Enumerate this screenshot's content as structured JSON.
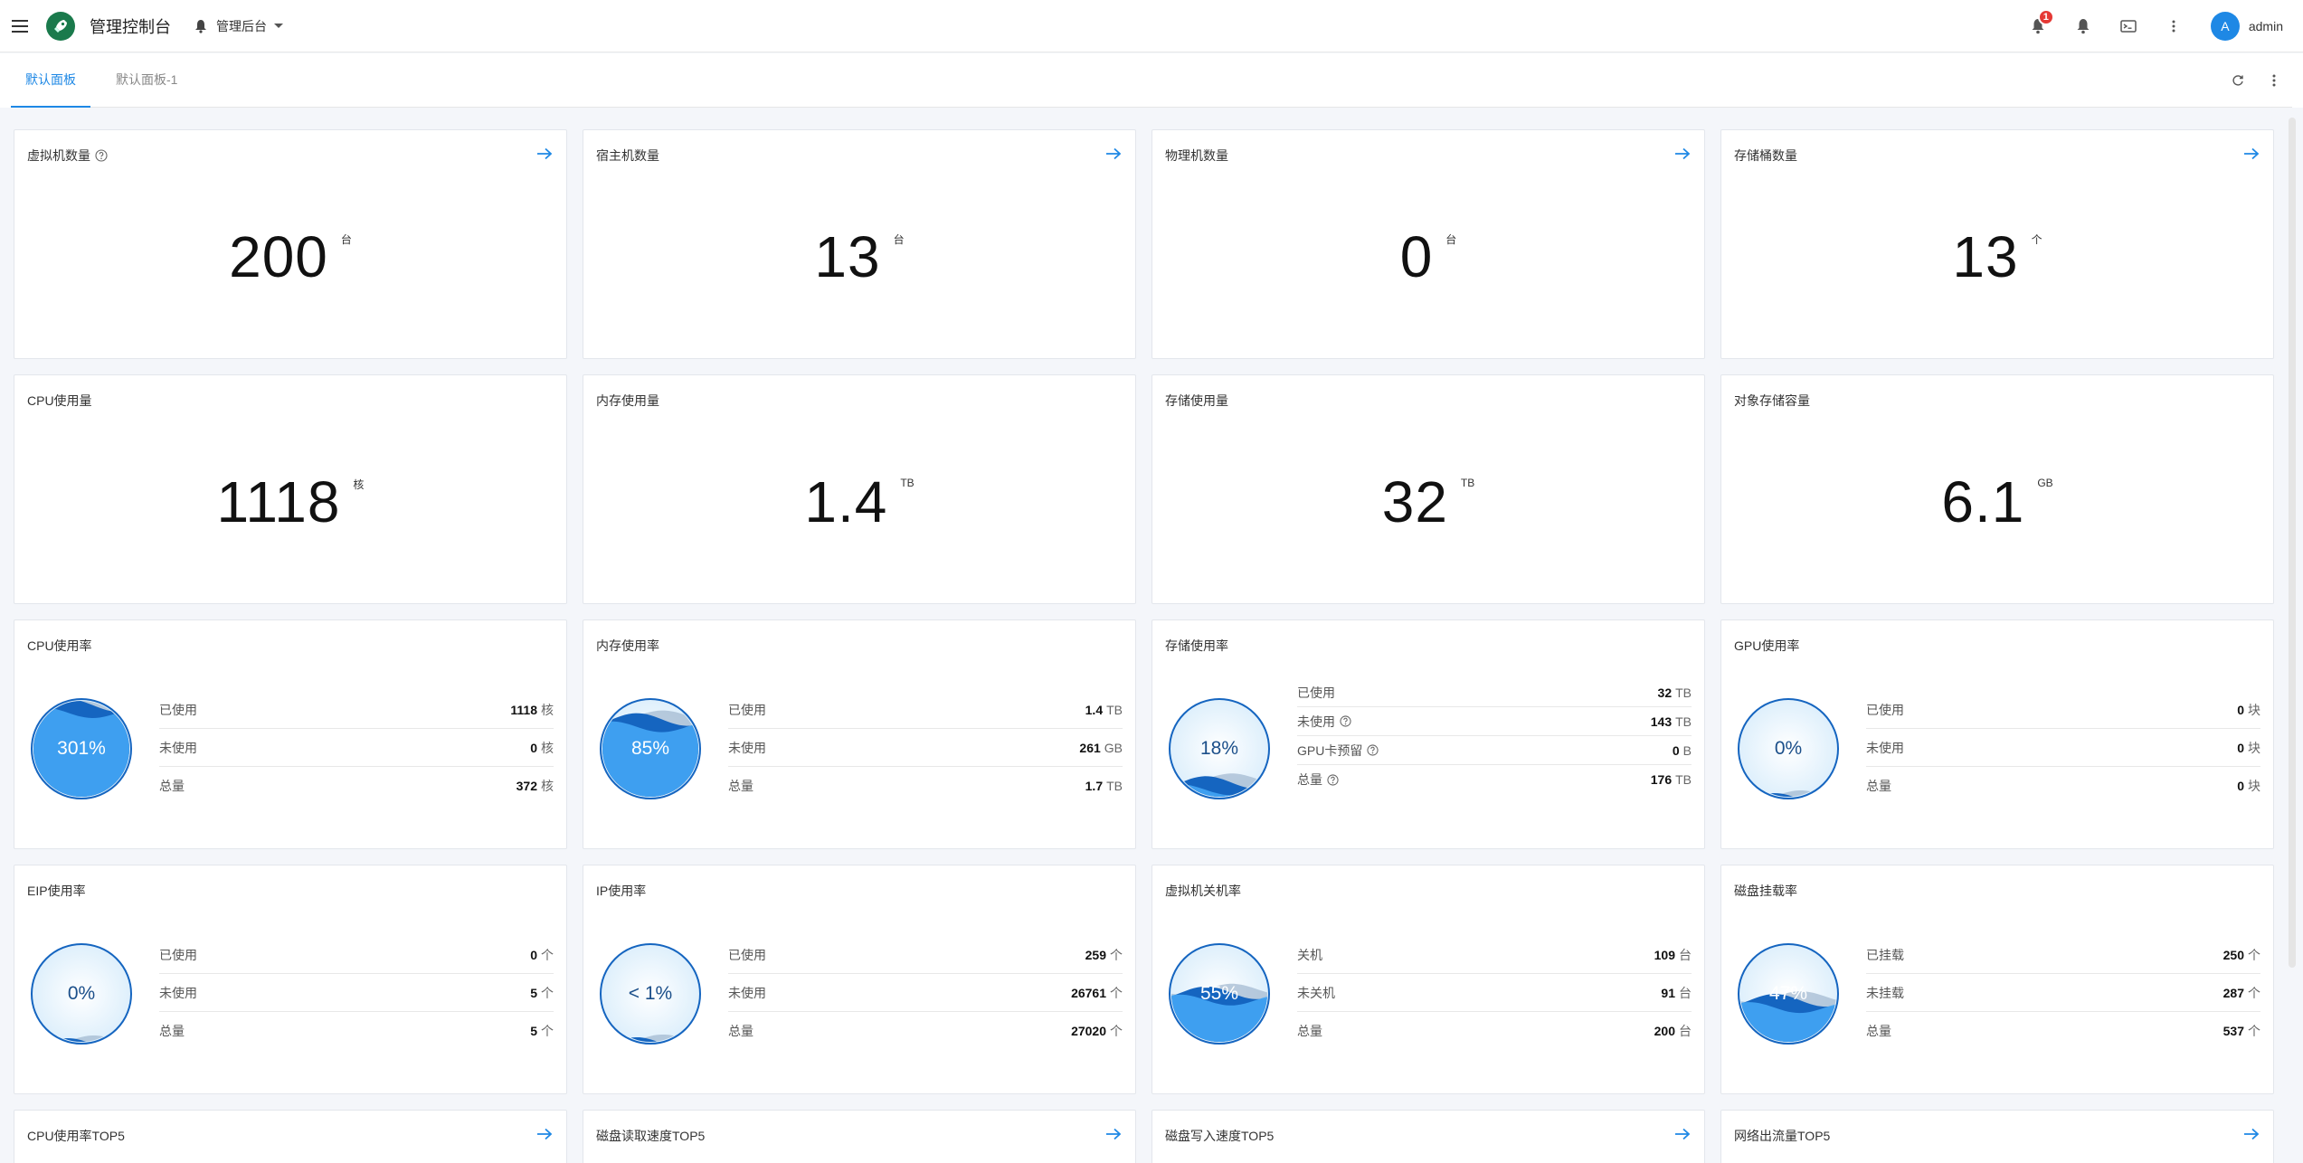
{
  "header": {
    "app_title": "管理控制台",
    "project": "管理后台",
    "notification_count": "1",
    "user_initial": "A",
    "username": "admin"
  },
  "tabs": [
    {
      "label": "默认面板",
      "active": true
    },
    {
      "label": "默认面板-1",
      "active": false
    }
  ],
  "stat_cards": [
    {
      "title": "虚拟机数量",
      "value": "200",
      "unit": "台",
      "help": true
    },
    {
      "title": "宿主机数量",
      "value": "13",
      "unit": "台"
    },
    {
      "title": "物理机数量",
      "value": "0",
      "unit": "台"
    },
    {
      "title": "存储桶数量",
      "value": "13",
      "unit": "个"
    },
    {
      "title": "CPU使用量",
      "value": "1118",
      "unit": "核"
    },
    {
      "title": "内存使用量",
      "value": "1.4",
      "unit": "TB"
    },
    {
      "title": "存储使用量",
      "value": "32",
      "unit": "TB"
    },
    {
      "title": "对象存储容量",
      "value": "6.1",
      "unit": "GB"
    }
  ],
  "usage_cards": [
    {
      "title": "CPU使用率",
      "percent": "301%",
      "fill": 1.0,
      "rows": [
        {
          "label": "已使用",
          "value": "1118",
          "unit": "核"
        },
        {
          "label": "未使用",
          "value": "0",
          "unit": "核"
        },
        {
          "label": "总量",
          "value": "372",
          "unit": "核"
        }
      ]
    },
    {
      "title": "内存使用率",
      "percent": "85%",
      "fill": 0.85,
      "rows": [
        {
          "label": "已使用",
          "value": "1.4",
          "unit": "TB"
        },
        {
          "label": "未使用",
          "value": "261",
          "unit": "GB"
        },
        {
          "label": "总量",
          "value": "1.7",
          "unit": "TB"
        }
      ]
    },
    {
      "title": "存储使用率",
      "percent": "18%",
      "fill": 0.18,
      "rows": [
        {
          "label": "已使用",
          "value": "32",
          "unit": "TB"
        },
        {
          "label": "未使用",
          "value": "143",
          "unit": "TB",
          "help": true
        },
        {
          "label": "GPU卡预留",
          "value": "0",
          "unit": "B",
          "help": true
        },
        {
          "label": "总量",
          "value": "176",
          "unit": "TB",
          "help": true
        }
      ]
    },
    {
      "title": "GPU使用率",
      "percent": "0%",
      "fill": 0.0,
      "rows": [
        {
          "label": "已使用",
          "value": "0",
          "unit": "块"
        },
        {
          "label": "未使用",
          "value": "0",
          "unit": "块"
        },
        {
          "label": "总量",
          "value": "0",
          "unit": "块"
        }
      ]
    },
    {
      "title": "EIP使用率",
      "percent": "0%",
      "fill": 0.0,
      "rows": [
        {
          "label": "已使用",
          "value": "0",
          "unit": "个"
        },
        {
          "label": "未使用",
          "value": "5",
          "unit": "个"
        },
        {
          "label": "总量",
          "value": "5",
          "unit": "个"
        }
      ]
    },
    {
      "title": "IP使用率",
      "percent": "< 1%",
      "fill": 0.01,
      "rows": [
        {
          "label": "已使用",
          "value": "259",
          "unit": "个"
        },
        {
          "label": "未使用",
          "value": "26761",
          "unit": "个"
        },
        {
          "label": "总量",
          "value": "27020",
          "unit": "个"
        }
      ]
    },
    {
      "title": "虚拟机关机率",
      "percent": "55%",
      "fill": 0.55,
      "rows": [
        {
          "label": "关机",
          "value": "109",
          "unit": "台"
        },
        {
          "label": "未关机",
          "value": "91",
          "unit": "台"
        },
        {
          "label": "总量",
          "value": "200",
          "unit": "台"
        }
      ]
    },
    {
      "title": "磁盘挂载率",
      "percent": "47%",
      "fill": 0.47,
      "rows": [
        {
          "label": "已挂载",
          "value": "250",
          "unit": "个"
        },
        {
          "label": "未挂载",
          "value": "287",
          "unit": "个"
        },
        {
          "label": "总量",
          "value": "537",
          "unit": "个"
        }
      ]
    }
  ],
  "top5_cards": [
    {
      "title": "CPU使用率TOP5"
    },
    {
      "title": "磁盘读取速度TOP5"
    },
    {
      "title": "磁盘写入速度TOP5"
    },
    {
      "title": "网络出流量TOP5"
    }
  ],
  "colors": {
    "primary": "#1e88e5",
    "wave_dark": "#1565c0",
    "wave_light": "#42a5f5",
    "badge": "#e53935"
  }
}
